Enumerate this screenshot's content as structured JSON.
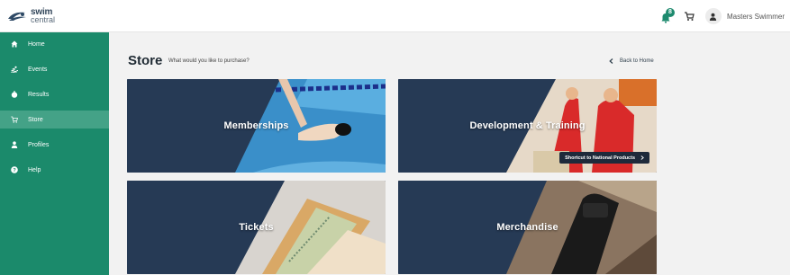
{
  "header": {
    "logo_line1": "swim",
    "logo_line2": "central",
    "notification_count": "8",
    "user_name": "Masters Swimmer"
  },
  "sidebar": {
    "items": [
      {
        "label": "Home",
        "icon": "home-icon",
        "active": false
      },
      {
        "label": "Events",
        "icon": "swimmer-icon",
        "active": false
      },
      {
        "label": "Results",
        "icon": "stopwatch-icon",
        "active": false
      },
      {
        "label": "Store",
        "icon": "cart-icon",
        "active": true
      },
      {
        "label": "Profiles",
        "icon": "person-icon",
        "active": false
      },
      {
        "label": "Help",
        "icon": "help-icon",
        "active": false
      }
    ]
  },
  "main": {
    "title": "Store",
    "subtitle": "What would you like to purchase?",
    "back_label": "Back to Home",
    "cards": [
      {
        "label": "Memberships"
      },
      {
        "label": "Development & Training",
        "shortcut_label": "Shortcut to National Products"
      },
      {
        "label": "Tickets"
      },
      {
        "label": "Merchandise"
      }
    ]
  },
  "colors": {
    "brand_green": "#1b8a6b",
    "active_green": "#44a287",
    "card_overlay": "#2a3d57",
    "page_bg": "#f2f2f2"
  }
}
